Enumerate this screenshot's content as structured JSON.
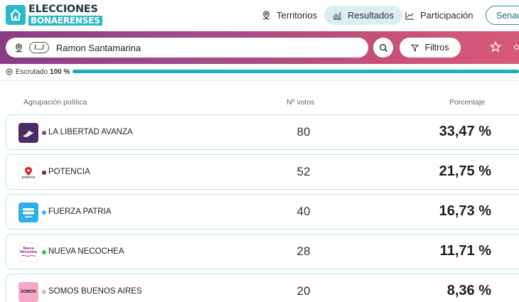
{
  "header": {
    "logo_line1": "ELECCIONES",
    "logo_line2": "BONAERENSES",
    "nav": [
      {
        "label": "Territorios",
        "icon": "map-pin-icon"
      },
      {
        "label": "Resultados",
        "icon": "bar-chart-icon",
        "active": true
      },
      {
        "label": "Participación",
        "icon": "line-chart-icon"
      }
    ],
    "senado_label": "Senado"
  },
  "search": {
    "path_chip": "/.../",
    "value": "Ramon Santamarina",
    "filter_label": "Filtros"
  },
  "escrutado": {
    "label": "Escrutado",
    "value": "100 %",
    "progress": 1.0
  },
  "table": {
    "headers": {
      "party": "Agrupación política",
      "votes": "Nº votos",
      "pct": "Porcentaje"
    },
    "rows": [
      {
        "name": "LA LIBERTAD AVANZA",
        "votes": "80",
        "pct": "33,47 %",
        "color": "#7b3fa8",
        "logo_bg": "#4b2b66"
      },
      {
        "name": "POTENCIA",
        "votes": "52",
        "pct": "21,75 %",
        "color": "#7a2a2a",
        "logo_bg": "#ffffff",
        "logo_text": "potencia"
      },
      {
        "name": "FUERZA PATRIA",
        "votes": "40",
        "pct": "16,73 %",
        "color": "#3ab0e6",
        "logo_bg": "#2cb0e8"
      },
      {
        "name": "NUEVA NECOCHEA",
        "votes": "28",
        "pct": "11,71 %",
        "color": "#2ecc40",
        "logo_bg": "#ffffff",
        "logo_text": "Nueva Necochea"
      },
      {
        "name": "SOMOS BUENOS AIRES",
        "votes": "20",
        "pct": "8,36 %",
        "color": "#f3a6c4",
        "logo_bg": "#f7a8c8",
        "logo_text": "SOMOS"
      }
    ]
  }
}
